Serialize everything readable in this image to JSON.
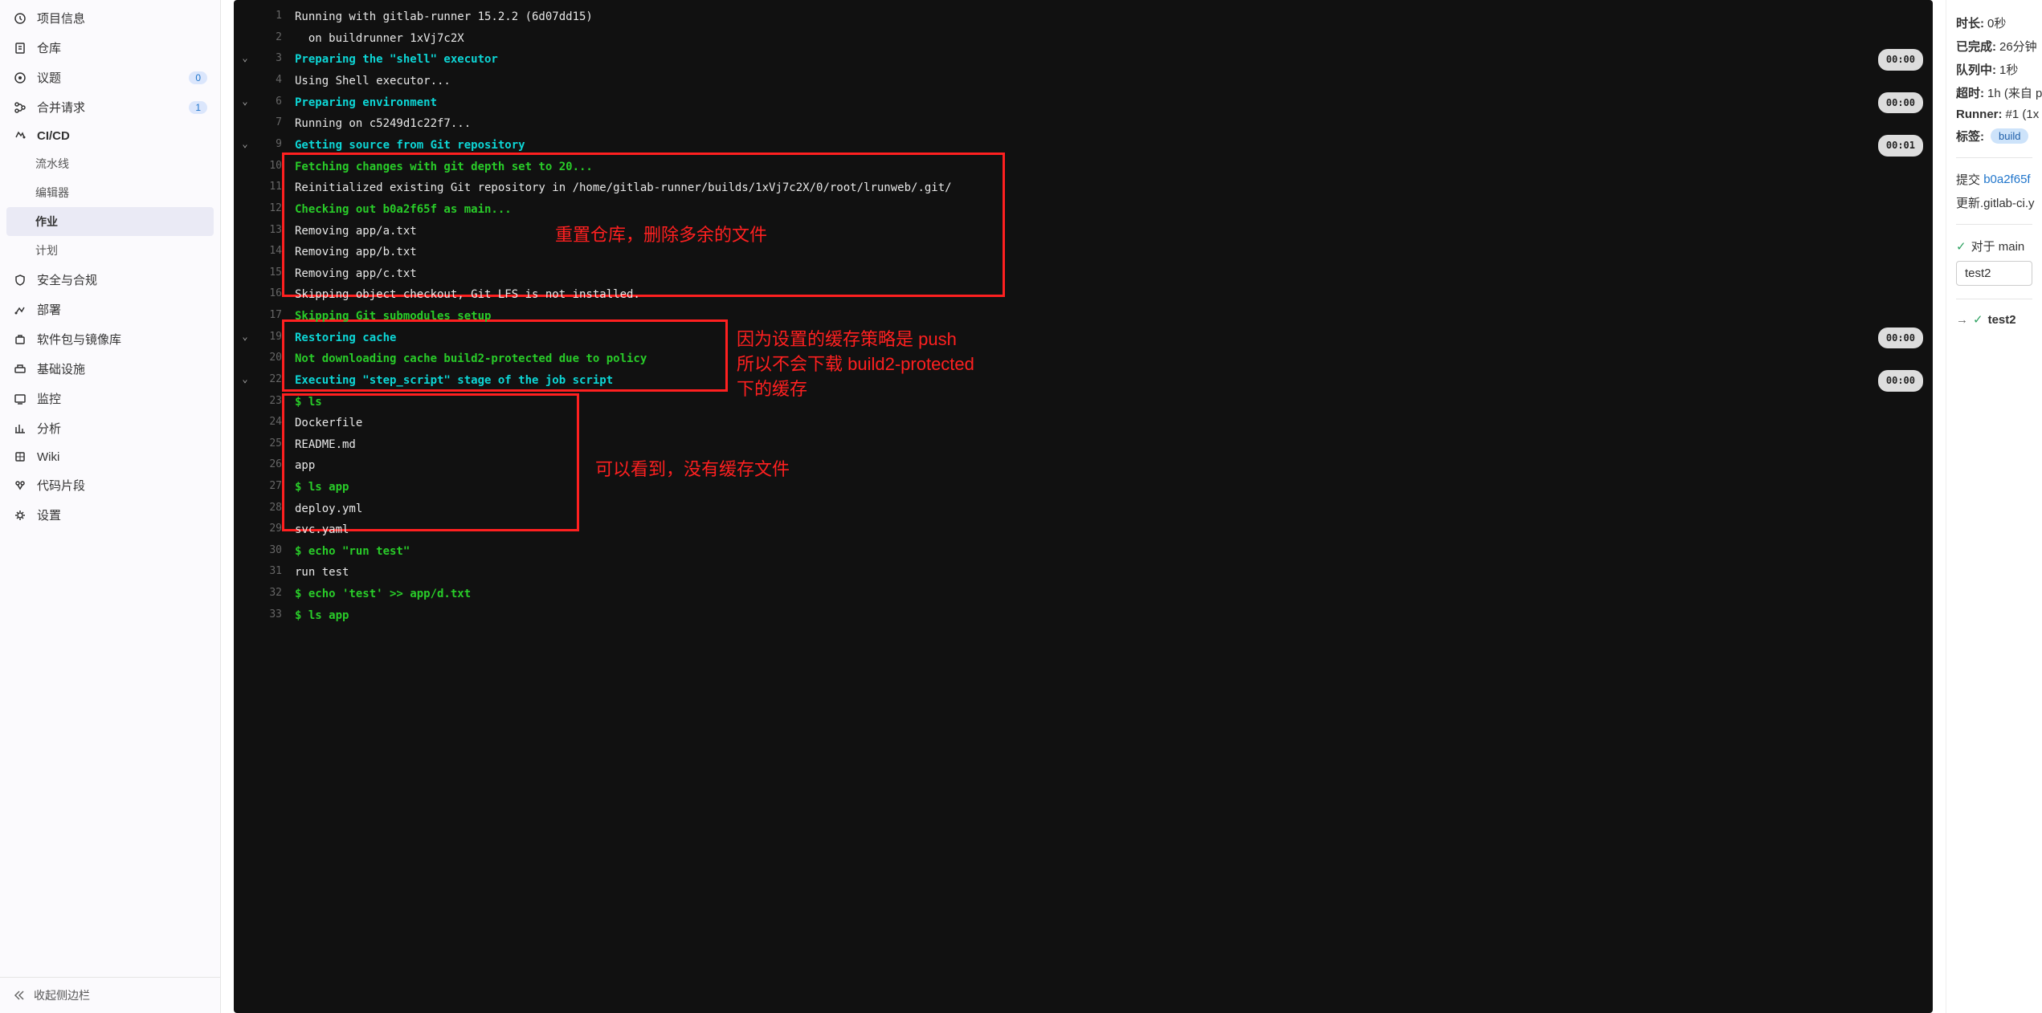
{
  "sidebar": {
    "items": [
      {
        "label": "项目信息"
      },
      {
        "label": "仓库"
      },
      {
        "label": "议题",
        "badge": "0"
      },
      {
        "label": "合并请求",
        "badge": "1"
      },
      {
        "label": "CI/CD"
      },
      {
        "label": "流水线",
        "sub": true
      },
      {
        "label": "编辑器",
        "sub": true
      },
      {
        "label": "作业",
        "sub": true,
        "active": true
      },
      {
        "label": "计划",
        "sub": true
      },
      {
        "label": "安全与合规"
      },
      {
        "label": "部署"
      },
      {
        "label": "软件包与镜像库"
      },
      {
        "label": "基础设施"
      },
      {
        "label": "监控"
      },
      {
        "label": "分析"
      },
      {
        "label": "Wiki"
      },
      {
        "label": "代码片段"
      },
      {
        "label": "设置"
      }
    ],
    "collapse": "收起侧边栏"
  },
  "log": {
    "lines": [
      {
        "n": 1,
        "cls": "c-white",
        "txt": "Running with gitlab-runner 15.2.2 (6d07dd15)"
      },
      {
        "n": 2,
        "cls": "c-white",
        "txt": "  on buildrunner 1xVj7c2X"
      },
      {
        "n": 3,
        "cls": "c-cyan",
        "txt": "Preparing the \"shell\" executor",
        "toggle": true,
        "time": "00:00"
      },
      {
        "n": 4,
        "cls": "c-white",
        "txt": "Using Shell executor..."
      },
      {
        "n": 6,
        "cls": "c-cyan",
        "txt": "Preparing environment",
        "toggle": true,
        "time": "00:00"
      },
      {
        "n": 7,
        "cls": "c-white",
        "txt": "Running on c5249d1c22f7..."
      },
      {
        "n": 9,
        "cls": "c-cyan",
        "txt": "Getting source from Git repository",
        "toggle": true,
        "time": "00:01"
      },
      {
        "n": 10,
        "cls": "c-green",
        "txt": "Fetching changes with git depth set to 20..."
      },
      {
        "n": 11,
        "cls": "c-white",
        "txt": "Reinitialized existing Git repository in /home/gitlab-runner/builds/1xVj7c2X/0/root/lrunweb/.git/"
      },
      {
        "n": 12,
        "cls": "c-green",
        "txt": "Checking out b0a2f65f as main..."
      },
      {
        "n": 13,
        "cls": "c-white",
        "txt": "Removing app/a.txt"
      },
      {
        "n": 14,
        "cls": "c-white",
        "txt": "Removing app/b.txt"
      },
      {
        "n": 15,
        "cls": "c-white",
        "txt": "Removing app/c.txt"
      },
      {
        "n": 16,
        "cls": "c-white",
        "txt": "Skipping object checkout, Git LFS is not installed."
      },
      {
        "n": 17,
        "cls": "c-green",
        "txt": "Skipping Git submodules setup"
      },
      {
        "n": 19,
        "cls": "c-cyan",
        "txt": "Restoring cache",
        "toggle": true,
        "time": "00:00"
      },
      {
        "n": 20,
        "cls": "c-green",
        "txt": "Not downloading cache build2-protected due to policy"
      },
      {
        "n": 22,
        "cls": "c-cyan",
        "txt": "Executing \"step_script\" stage of the job script",
        "toggle": true,
        "time": "00:00"
      },
      {
        "n": 23,
        "cls": "c-green",
        "txt": "$ ls"
      },
      {
        "n": 24,
        "cls": "c-white",
        "txt": "Dockerfile"
      },
      {
        "n": 25,
        "cls": "c-white",
        "txt": "README.md"
      },
      {
        "n": 26,
        "cls": "c-white",
        "txt": "app"
      },
      {
        "n": 27,
        "cls": "c-green",
        "txt": "$ ls app"
      },
      {
        "n": 28,
        "cls": "c-white",
        "txt": "deploy.yml"
      },
      {
        "n": 29,
        "cls": "c-white",
        "txt": "svc.yaml"
      },
      {
        "n": 30,
        "cls": "c-green",
        "txt": "$ echo \"run test\""
      },
      {
        "n": 31,
        "cls": "c-white",
        "txt": "run test"
      },
      {
        "n": 32,
        "cls": "c-green",
        "txt": "$ echo 'test' >> app/d.txt"
      },
      {
        "n": 33,
        "cls": "c-green",
        "txt": "$ ls app"
      }
    ]
  },
  "annotations": {
    "a1": "重置仓库，删除多余的文件",
    "a2": "因为设置的缓存策略是 push\n所以不会下载 build2-protected\n下的缓存",
    "a3": "可以看到，没有缓存文件"
  },
  "right": {
    "duration_label": "时长:",
    "duration_val": "0秒",
    "finished_label": "已完成:",
    "finished_val": "26分钟",
    "queued_label": "队列中:",
    "queued_val": "1秒",
    "timeout_label": "超时:",
    "timeout_val": "1h (来自 p",
    "runner_label": "Runner:",
    "runner_val": "#1 (1x",
    "tags_label": "标签:",
    "tag_val": "build",
    "commit_label": "提交",
    "commit_hash": "b0a2f65f",
    "commit_msg": "更新.gitlab-ci.y",
    "branch_label": "对于 main",
    "job_name": "test2",
    "pipeline_job": "test2"
  }
}
